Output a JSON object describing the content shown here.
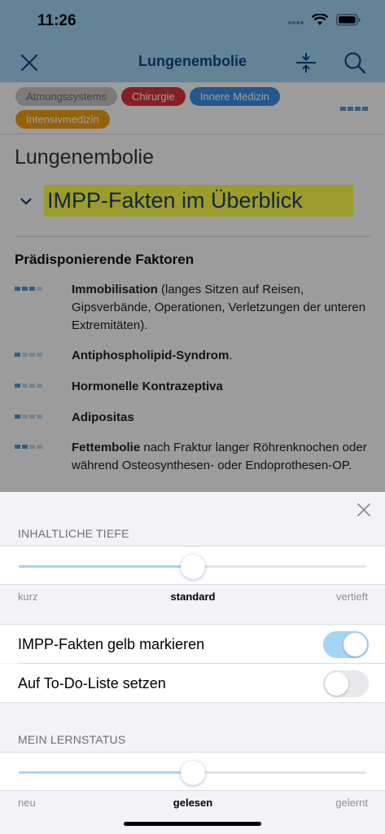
{
  "status": {
    "time": "11:26"
  },
  "nav": {
    "title": "Lungenembolie"
  },
  "article": {
    "tags": [
      {
        "label": "Atmungssystems",
        "color": "#c9c9c9"
      },
      {
        "label": "Chirurgie",
        "color": "#d9343c"
      },
      {
        "label": "Innere Medizin",
        "color": "#3d8fe8"
      },
      {
        "label": "Intensivmedizin",
        "color": "#f5a10f"
      }
    ],
    "title": "Lungenembolie",
    "section_title": "IMPP-Fakten im Überblick",
    "subheading": "Prädisponierende Faktoren",
    "items": [
      {
        "bold": "Immobilisation",
        "rest": " (langes Sitzen auf Reisen, Gipsverbände, Operationen, Verletzungen der unteren Extremitäten).",
        "relevance": 3
      },
      {
        "bold": "Antiphospholipid-Syndrom",
        "rest": ".",
        "relevance": 1
      },
      {
        "bold": "Hormonelle Kontrazeptiva",
        "rest": "",
        "relevance": 1
      },
      {
        "bold": "Adipositas",
        "rest": "",
        "relevance": 1
      },
      {
        "bold": "Fettembolie",
        "rest": " nach Fraktur langer Röhrenknochen oder während Osteosynthesen- oder Endoprothesen-OP.",
        "relevance": 2
      }
    ]
  },
  "sheet": {
    "depth": {
      "label": "INHALTLICHE TIEFE",
      "min_label": "kurz",
      "selected_label": "standard",
      "max_label": "vertieft",
      "value_fraction": 0.5
    },
    "toggles": [
      {
        "label": "IMPP-Fakten gelb markieren",
        "on": true
      },
      {
        "label": "Auf To-Do-Liste setzen",
        "on": false
      }
    ],
    "learn_status": {
      "label": "MEIN LERNSTATUS",
      "min_label": "neu",
      "selected_label": "gelesen",
      "max_label": "gelernt",
      "value_fraction": 0.5
    }
  },
  "colors": {
    "nav_bg": "#a4d6f6",
    "accent": "#a6d4f5",
    "highlight": "#ffff4a",
    "title_blue": "#0c4a8c"
  },
  "icons": [
    "wifi-icon",
    "battery-icon",
    "close-icon",
    "collapse-icon",
    "search-icon",
    "chevron-down-icon",
    "relevance-dots-icon"
  ]
}
